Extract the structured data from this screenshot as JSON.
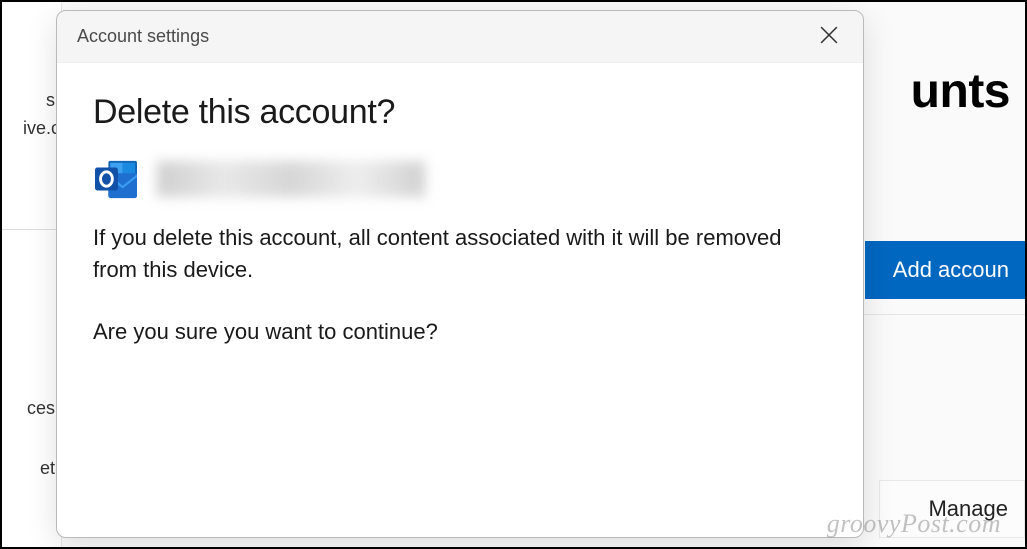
{
  "background": {
    "page_title_fragment": "unts",
    "sidebar_fragments": {
      "s": "s",
      "ive": "ive.c",
      "ces": "ces",
      "et": "et"
    },
    "add_account_label": "Add accoun",
    "manage_label": "Manage"
  },
  "modal": {
    "titlebar": "Account settings",
    "heading": "Delete this account?",
    "warning_text": "If you delete this account, all content associated with it will be removed from this device.",
    "confirm_text": "Are you sure you want to continue?",
    "icon": "outlook-icon"
  },
  "watermark": "groovyPost.com"
}
